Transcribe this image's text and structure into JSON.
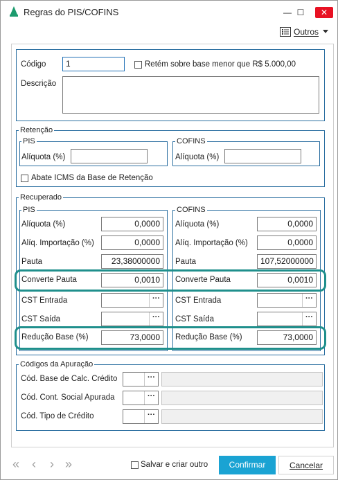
{
  "window": {
    "title": "Regras do PIS/COFINS",
    "minimize_symbol": "—",
    "maximize_symbol": "☐",
    "close_symbol": "✕"
  },
  "toolbar": {
    "outros_label": "Outros",
    "outros_icon": "list-icon"
  },
  "header": {
    "codigo_label": "Código",
    "codigo_value": "1",
    "retem_label": "Retém sobre base menor que R$ 5.000,00",
    "descricao_label": "Descrição",
    "descricao_value": ""
  },
  "retencao": {
    "legend": "Retenção",
    "pis": {
      "legend": "PIS",
      "aliquota_label": "Alíquota (%)",
      "aliquota_value": ""
    },
    "cofins": {
      "legend": "COFINS",
      "aliquota_label": "Alíquota (%)",
      "aliquota_value": ""
    },
    "abate_label": "Abate ICMS da Base de Retenção"
  },
  "recuperado": {
    "legend": "Recuperado",
    "pis": {
      "legend": "PIS",
      "aliquota_label": "Alíquota (%)",
      "aliquota_value": "0,0000",
      "importacao_label": "Alíq. Importação (%)",
      "importacao_value": "0,0000",
      "pauta_label": "Pauta",
      "pauta_value": "23,38000000",
      "converte_label": "Converte Pauta",
      "converte_value": "0,0010",
      "cst_entrada_label": "CST Entrada",
      "cst_entrada_value": "",
      "cst_saida_label": "CST Saída",
      "cst_saida_value": "",
      "reducao_label": "Redução Base (%)",
      "reducao_value": "73,0000"
    },
    "cofins": {
      "legend": "COFINS",
      "aliquota_label": "Alíquota (%)",
      "aliquota_value": "0,0000",
      "importacao_label": "Alíq. Importação  (%)",
      "importacao_value": "0,0000",
      "pauta_label": "Pauta",
      "pauta_value": "107,52000000",
      "converte_label": "Converte Pauta",
      "converte_value": "0,0010",
      "cst_entrada_label": "CST Entrada",
      "cst_entrada_value": "",
      "cst_saida_label": "CST Saída",
      "cst_saida_value": "",
      "reducao_label": "Redução Base (%)",
      "reducao_value": "73,0000"
    },
    "lookup_symbol": "···"
  },
  "apuracao": {
    "legend": "Códigos da Apuração",
    "base_label": "Cód. Base de Calc. Crédito",
    "contribuicao_label": "Cód. Cont. Social Apurada",
    "tipo_label": "Cód. Tipo de Crédito"
  },
  "footer": {
    "nav_first": "«",
    "nav_prev": "‹",
    "nav_next": "›",
    "nav_last": "»",
    "salvar_label": "Salvar e criar outro",
    "confirmar_label": "Confirmar",
    "cancelar_label": "Cancelar"
  },
  "colors": {
    "accent": "#1aa3d3",
    "highlight": "#1f8f8c",
    "group_border": "#2a6ea0",
    "close": "#e81123"
  }
}
